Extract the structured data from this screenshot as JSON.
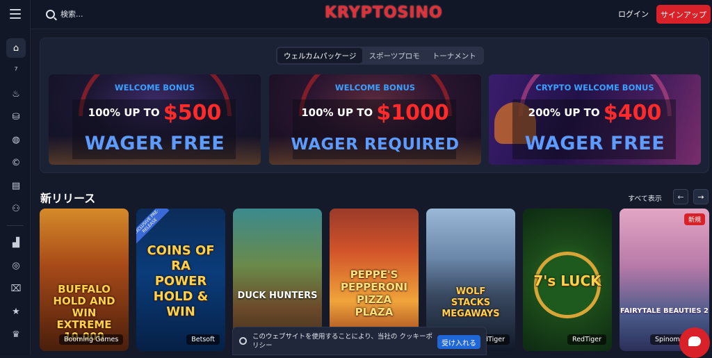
{
  "sidebar": {
    "menu_icon": "hamburger-menu-icon",
    "items": [
      {
        "icon": "home-icon",
        "glyph": "⌂",
        "active": true
      },
      {
        "icon": "slots-777-icon",
        "glyph": "⁷"
      },
      {
        "icon": "fire-icon",
        "glyph": "♨"
      },
      {
        "icon": "casino-chip-icon",
        "glyph": "⛁"
      },
      {
        "icon": "basketball-icon",
        "glyph": "◍"
      },
      {
        "icon": "crypto-coin-icon",
        "glyph": "©"
      },
      {
        "icon": "cards-icon",
        "glyph": "▤"
      },
      {
        "icon": "live-dealer-icon",
        "glyph": "⚇"
      },
      {
        "icon": "leaderboard-icon",
        "glyph": "▟"
      },
      {
        "icon": "roulette-icon",
        "glyph": "◎"
      },
      {
        "icon": "gift-icon",
        "glyph": "⌧"
      },
      {
        "icon": "star-icon",
        "glyph": "★"
      },
      {
        "icon": "crown-icon",
        "glyph": "♛"
      }
    ]
  },
  "header": {
    "search_placeholder": "検索...",
    "logo_text": "KRYPTOSINO",
    "login_label": "ログイン",
    "signup_label": "サインアップ"
  },
  "promo": {
    "tabs": [
      "ウェルカムパッケージ",
      "スポーツプロモ",
      "トーナメント"
    ],
    "active_tab": 0,
    "banners": [
      {
        "tag": "WELCOME BONUS",
        "line1_prefix": "100% UP TO",
        "amount": "$500",
        "line2": "WAGER FREE"
      },
      {
        "tag": "WELCOME BONUS",
        "line1_prefix": "100% UP TO",
        "amount": "$1000",
        "line2": "WAGER REQUIRED"
      },
      {
        "tag": "CRYPTO WELCOME BONUS",
        "line1_prefix": "200% UP TO",
        "amount": "$400",
        "line2": "WAGER FREE"
      }
    ]
  },
  "new_releases": {
    "title": "新リリース",
    "view_all": "すべて表示",
    "prev_icon": "←",
    "next_icon": "→",
    "games": [
      {
        "art_title": "BUFFALO HOLD AND WIN EXTREME 10,000",
        "provider": "Booming Games"
      },
      {
        "art_title": "COINS OF RA POWER HOLD & WIN",
        "provider": "Betsoft",
        "badge": "EXCLUSIVE PRE-RELEASE"
      },
      {
        "art_title": "DUCK HUNTERS",
        "provider": ""
      },
      {
        "art_title": "PEPPE'S PEPPERONI PIZZA PLAZA",
        "provider": ""
      },
      {
        "art_title": "WOLF STACKS MEGAWAYS",
        "provider": "dTiger"
      },
      {
        "art_title": "7's LUCK",
        "provider": "RedTiger"
      },
      {
        "art_title": "FAIRYTALE BEAUTIES 2",
        "provider": "Spinom",
        "badge": "新規"
      }
    ]
  },
  "cookie_banner": {
    "text": "このウェブサイトを使用することにより、当社の クッキーポリシー",
    "accept_label": "受け入れる"
  }
}
